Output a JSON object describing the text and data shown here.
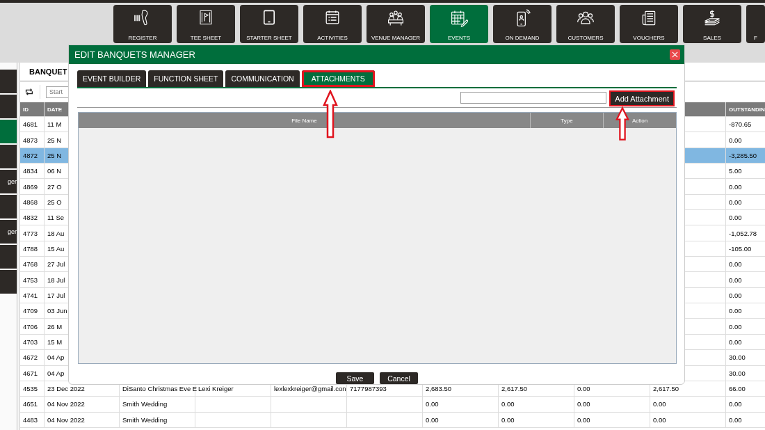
{
  "nav_tiles": [
    {
      "label": "REGISTER",
      "kind": "scanner",
      "selected": false
    },
    {
      "label": "TEE SHEET",
      "kind": "flag",
      "selected": false
    },
    {
      "label": "STARTER SHEET",
      "kind": "tablet",
      "selected": false
    },
    {
      "label": "ACTIVITIES",
      "kind": "calendar",
      "selected": false
    },
    {
      "label": "VENUE MANAGER",
      "kind": "meeting",
      "selected": false
    },
    {
      "label": "EVENTS",
      "kind": "event",
      "selected": true
    },
    {
      "label": "ON DEMAND",
      "kind": "phone",
      "selected": false
    },
    {
      "label": "CUSTOMERS",
      "kind": "people",
      "selected": false
    },
    {
      "label": "VOUCHERS",
      "kind": "document",
      "selected": false
    },
    {
      "label": "SALES",
      "kind": "money",
      "selected": false
    },
    {
      "label": "F",
      "kind": "none",
      "selected": false
    }
  ],
  "sidebar": {
    "items": [
      {
        "selected": false
      },
      {
        "selected": false
      },
      {
        "selected": true
      },
      {
        "selected": false
      },
      {
        "label": "ger",
        "selected": false
      },
      {
        "selected": false
      },
      {
        "label": "ger",
        "selected": false
      },
      {
        "selected": false
      },
      {
        "selected": false
      }
    ]
  },
  "panel": {
    "tab": "BANQUET",
    "search": {
      "placeholder": "Start"
    }
  },
  "table": {
    "columns": [
      "ID",
      "DATE",
      "OUTSTANDIN"
    ],
    "rows": [
      {
        "id": "4681",
        "date": "11 M",
        "outstanding": "-870.65",
        "selected": false
      },
      {
        "id": "4873",
        "date": "25 N",
        "outstanding": "0.00",
        "selected": false
      },
      {
        "id": "4872",
        "date": "25 N",
        "outstanding": "-3,285.50",
        "selected": true
      },
      {
        "id": "4834",
        "date": "06 N",
        "outstanding": "5.00",
        "selected": false
      },
      {
        "id": "4869",
        "date": "27 O",
        "outstanding": "0.00",
        "selected": false
      },
      {
        "id": "4868",
        "date": "25 O",
        "outstanding": "0.00",
        "selected": false
      },
      {
        "id": "4832",
        "date": "11 Se",
        "outstanding": "0.00",
        "selected": false
      },
      {
        "id": "4773",
        "date": "18 Au",
        "outstanding": "-1,052.78",
        "selected": false
      },
      {
        "id": "4788",
        "date": "15 Au",
        "outstanding": "-105.00",
        "selected": false
      },
      {
        "id": "4768",
        "date": "27 Jul",
        "outstanding": "0.00",
        "selected": false
      },
      {
        "id": "4753",
        "date": "18 Jul",
        "outstanding": "0.00",
        "selected": false
      },
      {
        "id": "4741",
        "date": "17 Jul",
        "outstanding": "0.00",
        "selected": false
      },
      {
        "id": "4709",
        "date": "03 Jun",
        "outstanding": "0.00",
        "selected": false
      },
      {
        "id": "4706",
        "date": "26 M",
        "outstanding": "0.00",
        "selected": false
      },
      {
        "id": "4703",
        "date": "15 M",
        "outstanding": "0.00",
        "selected": false
      },
      {
        "id": "4672",
        "date": "04 Ap",
        "outstanding": "30.00",
        "selected": false
      },
      {
        "id": "4671",
        "date": "04 Ap",
        "outstanding": "30.00",
        "selected": false
      },
      {
        "id": "4535",
        "date": "23 Dec 2022",
        "details": {
          "column_3": "DiSanto Christmas Eve E",
          "column_4": "Lexi Kreiger",
          "column_5": "lexlexkreiger@gmail.con",
          "column_6": "7177987393",
          "column_7": "2,683.50",
          "column_8": "2,617.50",
          "column_9": "0.00",
          "column_10": "2,617.50"
        },
        "outstanding": "66.00",
        "selected": false
      },
      {
        "id": "4651",
        "date": "04 Nov 2022",
        "details": {
          "column_3": "Smith Wedding",
          "column_7": "0.00",
          "column_8": "0.00",
          "column_9": "0.00",
          "column_10": "0.00"
        },
        "outstanding": "0.00",
        "selected": false
      },
      {
        "id": "4483",
        "date": "04 Nov 2022",
        "details": {
          "column_3": "Smith Wedding",
          "column_7": "0.00",
          "column_8": "0.00",
          "column_9": "0.00",
          "column_10": "0.00"
        },
        "outstanding": "0.00",
        "selected": false
      }
    ]
  },
  "dialog": {
    "title": "EDIT BANQUETS MANAGER",
    "tabs": [
      {
        "label": "EVENT BUILDER",
        "selected": false,
        "highlighted": false
      },
      {
        "label": "FUNCTION SHEET",
        "selected": false,
        "highlighted": false
      },
      {
        "label": "COMMUNICATION",
        "selected": false,
        "highlighted": false
      },
      {
        "label": "ATTACHMENTS",
        "selected": true,
        "highlighted": true
      }
    ],
    "add_button": {
      "label": "Add Attachment",
      "highlighted": true
    },
    "grid": {
      "columns": [
        "File Name",
        "Type",
        "Action"
      ]
    },
    "buttons": [
      "Save",
      "Cancel"
    ]
  }
}
